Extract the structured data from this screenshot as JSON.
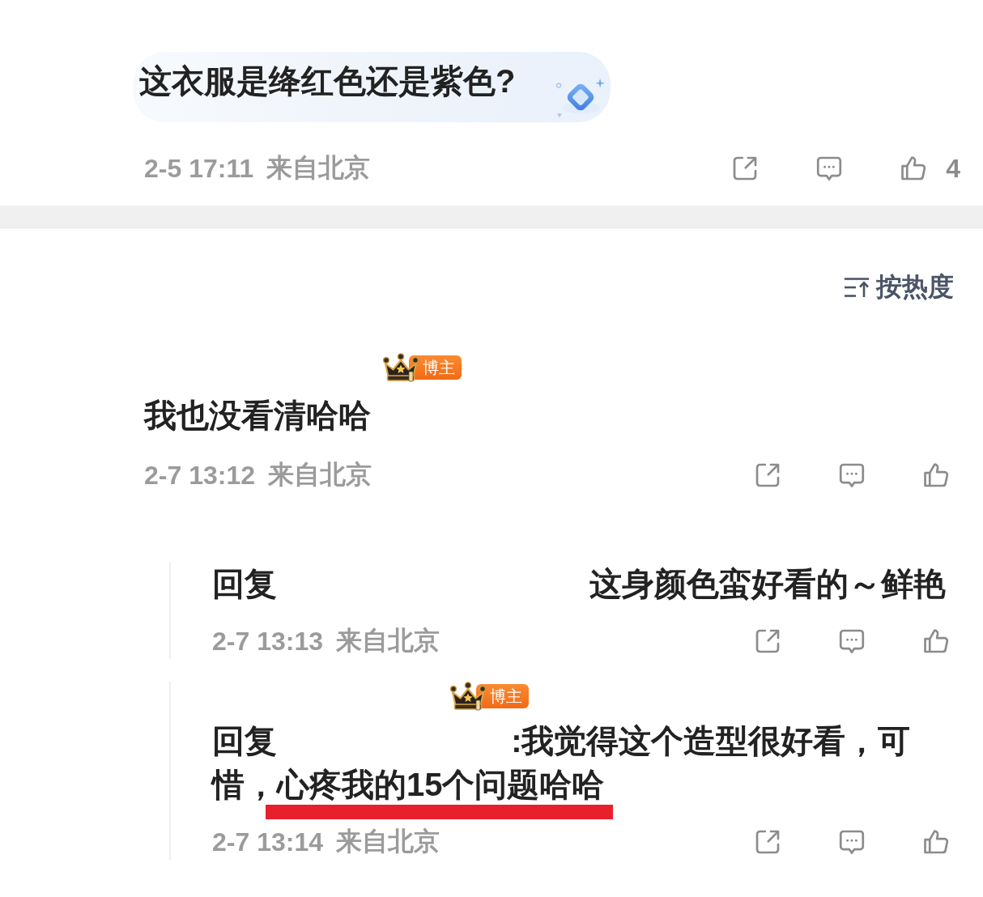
{
  "post_comment": {
    "text": "这衣服是绛红色还是紫色?",
    "time": "2-5 17:11",
    "location": "来自北京",
    "like_count": "4"
  },
  "sort": {
    "label": "按热度"
  },
  "comments": [
    {
      "badge": "博主",
      "text": "我也没看清哈哈",
      "time": "2-7 13:12",
      "location": "来自北京",
      "replies": [
        {
          "prefix": "回复",
          "segments": [
            {
              "text": "这身颜色蛮好看的～鲜艳",
              "underlined": false
            }
          ],
          "time": "2-7 13:13",
          "location": "来自北京"
        },
        {
          "badge": "博主",
          "prefix": "回复",
          "segments": [
            {
              "text": ":我觉得这个造型很好看，可惜，",
              "underlined": false
            },
            {
              "text": "心疼我的15个问题哈哈",
              "underlined": true
            }
          ],
          "time": "2-7 13:14",
          "location": "来自北京"
        }
      ]
    }
  ]
}
